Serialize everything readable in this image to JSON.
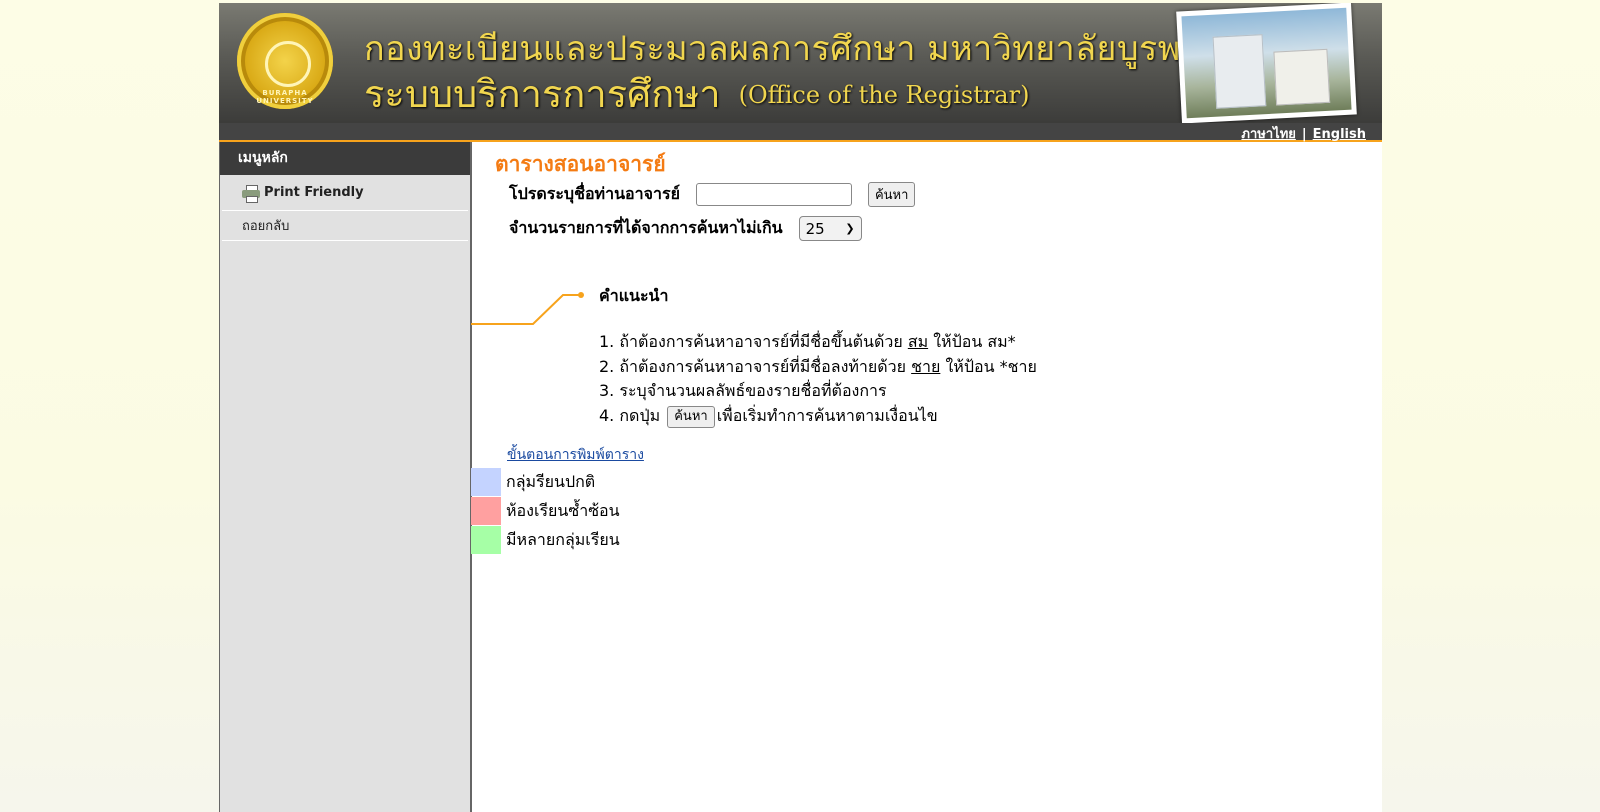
{
  "header": {
    "logo_text": "BURAPHA UNIVERSITY",
    "title": "กองทะเบียนและประมวลผลการศึกษา มหาวิทยาลัยบูรพา",
    "subtitle": "ระบบบริการการศึกษา",
    "subtitle_en": "(Office of the Registrar)",
    "lang_thai": "ภาษาไทย",
    "lang_sep": "|",
    "lang_english": "English"
  },
  "sidebar": {
    "heading": "เมนูหลัก",
    "items": [
      {
        "label": "Print Friendly",
        "icon": "printer-icon"
      },
      {
        "label": "ถอยกลับ"
      }
    ]
  },
  "main": {
    "title": "ตารางสอนอาจารย์",
    "name_label": "โปรดระบุชื่อท่านอาจารย์",
    "name_value": "",
    "search_button": "ค้นหา",
    "limit_label": "จำนวนรายการที่ได้จากการค้นหาไม่เกิน",
    "limit_value": "25",
    "guide_title": "คำแนะนำ",
    "steps": [
      {
        "num": "1.",
        "pre": "ถ้าต้องการค้นหาอาจารย์ที่มีชื่อขึ้นต้นด้วย",
        "u": "สม",
        "post": "ให้ป้อน สม*"
      },
      {
        "num": "2.",
        "pre": "ถ้าต้องการค้นหาอาจารย์ที่มีชื่อลงท้ายด้วย",
        "u": "ชาย",
        "post": "ให้ป้อน *ชาย"
      },
      {
        "num": "3.",
        "text": "ระบุจำนวนผลลัพธ์ของรายชื่อที่ต้องการ"
      },
      {
        "num": "4.",
        "pre": "กดปุ่ม",
        "button": "ค้นหา",
        "post": "เพื่อเริ่มทำการค้นหาตามเงื่อนไข"
      }
    ],
    "print_link": "ขั้นตอนการพิมพ์ตาราง",
    "legend": [
      {
        "label": "กลุ่มรียนปกติ",
        "color": "#c4d3ff"
      },
      {
        "label": "ห้องเรียนซ้ำซ้อน",
        "color": "#ffa0a0"
      },
      {
        "label": "มีหลายกลุ่มเรียน",
        "color": "#a6ffa6"
      }
    ]
  },
  "colors": {
    "accent": "#f47b13",
    "banner_text": "#f1d64f",
    "link": "#1a4aa0"
  }
}
